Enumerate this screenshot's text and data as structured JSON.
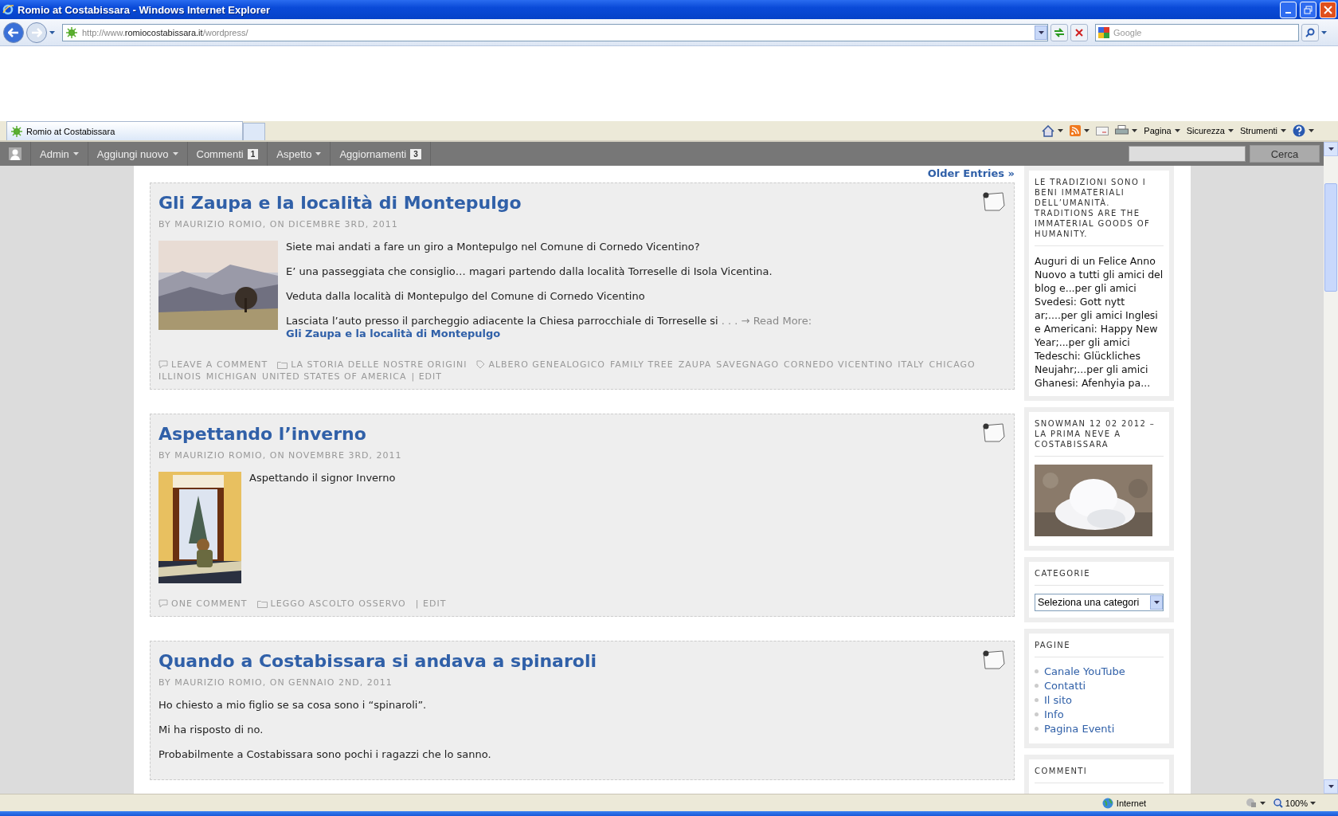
{
  "window": {
    "title": "Romio at Costabissara - Windows Internet Explorer"
  },
  "address_bar": {
    "url_prefix": "http://www.",
    "url_domain": "romiocostabissara.it",
    "url_path": "/wordpress/"
  },
  "search": {
    "placeholder": "Google"
  },
  "tabs": [
    {
      "label": "Romio at Costabissara",
      "selected": true
    }
  ],
  "command_bar": [
    {
      "label": "Pagina"
    },
    {
      "label": "Sicurezza"
    },
    {
      "label": "Strumenti"
    }
  ],
  "admin_bar": {
    "items": [
      {
        "label": "Admin",
        "kind": "menu"
      },
      {
        "label": "Aggiungi nuovo",
        "kind": "menu"
      },
      {
        "label": "Commenti",
        "kind": "count",
        "count": "1"
      },
      {
        "label": "Aspetto",
        "kind": "menu"
      },
      {
        "label": "Aggiornamenti",
        "kind": "count",
        "count": "3"
      }
    ],
    "search_button": "Cerca"
  },
  "older_entries": "Older Entries »",
  "posts": [
    {
      "title": "Gli Zaupa e la località di Montepulgo",
      "meta": "BY MAURIZIO ROMIO, ON DICEMBRE 3RD, 2011",
      "thumb": {
        "kind": "picture"
      },
      "paragraphs": [
        "Siete mai andati a fare un giro a Montepulgo nel Comune di Cornedo Vicentino?",
        "E’ una passeggiata che consiglio… magari partendo dalla località Torreselle di Isola Vicentina.",
        "Veduta dalla località di Montepulgo del Comune di Cornedo Vicentino",
        "Lasciata l’auto presso il parcheggio adiacente la Chiesa parrocchiale di Torreselle si"
      ],
      "read_more": {
        "prefix": ". . . → Read More:",
        "link": "Gli Zaupa e la località di Montepulgo"
      },
      "footer": {
        "comments": "LEAVE A COMMENT",
        "category": "LA STORIA DELLE NOSTRE ORIGINI",
        "tags": [
          "ALBERO GENEALOGICO",
          "FAMILY TREE",
          "ZAUPA",
          "SAVEGNAGO",
          "CORNEDO VICENTINO",
          "ITALY",
          "CHICAGO",
          "ILLINOIS",
          "MICHIGAN",
          "UNITED STATES OF AMERICA"
        ],
        "edit": "| EDIT"
      }
    },
    {
      "title": "Aspettando l’inverno",
      "meta": "BY MAURIZIO ROMIO, ON NOVEMBRE 3RD, 2011",
      "thumb": {
        "kind": "picture"
      },
      "paragraphs": [
        "Aspettando il signor Inverno"
      ],
      "footer": {
        "comments": "ONE COMMENT",
        "category": "LEGGO ASCOLTO OSSERVO",
        "edit": "| EDIT"
      }
    },
    {
      "title": "Quando a Costabissara si andava a spinaroli",
      "meta": "BY MAURIZIO ROMIO, ON GENNAIO 2ND, 2011",
      "paragraphs": [
        "Ho chiesto a mio figlio  se sa cosa sono i “spinaroli”.",
        "Mi ha risposto di no.",
        "Probabilmente a Costabissara sono pochi i ragazzi che lo sanno."
      ]
    }
  ],
  "sidebar": [
    {
      "kind": "text",
      "title": "LE TRADIZIONI SONO I BENI IMMATERIALI DELL’UMANITÀ. TRADITIONS ARE THE IMMATERIAL GOODS OF HUMANITY.",
      "body": "Auguri di un Felice Anno Nuovo a tutti gli amici del blog e...per gli amici Svedesi: Gott nytt ar;....per gli amici Inglesi e Americani: Happy New Year;...per gli amici Tedeschi: Glückliches Neujahr;...per gli amici Ghanesi: Afenhyia pa..."
    },
    {
      "title": "SNOWMAN 12 02 2012 – LA PRIMA NEVE A COSTABISSARA"
    },
    {
      "kind": "select",
      "title": "CATEGORIE",
      "value": "Seleziona una categori"
    },
    {
      "kind": "links",
      "title": "PAGINE",
      "links": [
        "Canale YouTube",
        "Contatti",
        "Il sito",
        "Info",
        "Pagina Eventi"
      ]
    },
    {
      "kind": "title",
      "title": "COMMENTI"
    }
  ],
  "status_bar": {
    "zone": "Internet",
    "zoom": "100%"
  }
}
